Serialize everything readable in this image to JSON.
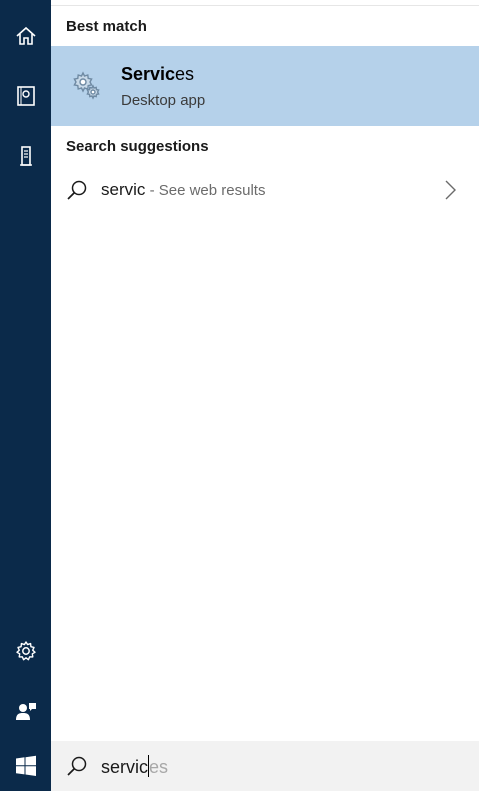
{
  "rail": {
    "items": [
      {
        "icon": "home-icon"
      },
      {
        "icon": "notebook-icon"
      },
      {
        "icon": "tower-icon"
      },
      {
        "icon": "gear-icon"
      },
      {
        "icon": "feedback-icon"
      },
      {
        "icon": "windows-logo-icon"
      }
    ],
    "background": "#0b2a4a"
  },
  "best_match": {
    "title": "Best match",
    "app_name_typed": "Servic",
    "app_name_rest": "es",
    "app_type": "Desktop app",
    "highlight_color": "#b5d1ea"
  },
  "suggestions": {
    "title": "Search suggestions",
    "items": [
      {
        "query": "servic",
        "hint": " - See web results"
      }
    ]
  },
  "search": {
    "typed": "servic",
    "autocomplete": "es"
  }
}
